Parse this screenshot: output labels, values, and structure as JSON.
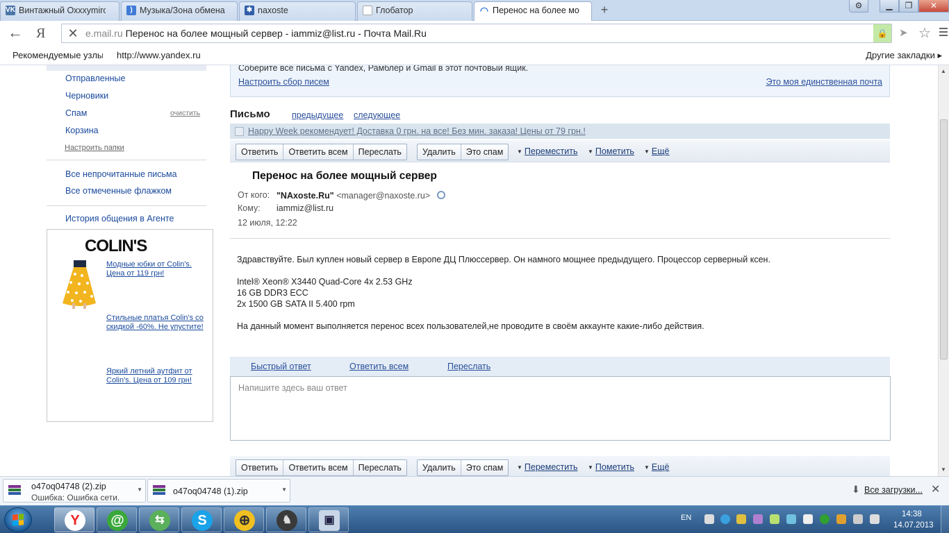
{
  "browser": {
    "tabs": [
      {
        "label": "Винтажный Охххуmiro",
        "favicon": "VK",
        "color": "#4a76a8"
      },
      {
        "label": "Музыка/Зона обмена",
        "favicon": ")",
        "color": "#3f7bd6"
      },
      {
        "label": "naxoste",
        "favicon": "✱",
        "color": "#2f5ea8"
      },
      {
        "label": "Глобатор",
        "favicon": "",
        "color": "#ffffff"
      },
      {
        "label": "Перенос на более мо",
        "favicon": "◠",
        "color": "#3f7bd6"
      }
    ],
    "new_tab_glyph": "+",
    "address": {
      "domain": "e.mail.ru",
      "title": "Перенос на более мощный сервер - iammiz@list.ru - Почта Mail.Ru"
    },
    "yandex_glyph": "Я",
    "bookmarks": {
      "recommended": "Рекомендуемые узлы",
      "yandex": "http://www.yandex.ru",
      "other": "Другие закладки"
    }
  },
  "sidebar": {
    "folders": [
      "Отправленные",
      "Черновики",
      "Спам",
      "Корзина"
    ],
    "clean_label": "очистить",
    "setup_folders": "Настроить папки",
    "all_unread": "Все непрочитанные письма",
    "all_flagged": "Все отмеченные флажком",
    "agent_history": "История общения в Агенте",
    "ad": {
      "brand": "COLIN'S",
      "links": [
        "Модные юбки от Colin's. Цена от 119 грн!",
        "Стильные платья Colin's со скидкой -60%. Не упустите!",
        "Яркий летний аутфит от Colin's. Цена от 109 грн!"
      ]
    }
  },
  "collector": {
    "text": "Соберите все письма с Yandex, Рамблер и Gmail в этот почтовый ящик.",
    "setup": "Настроить сбор писем",
    "only_mail": "Это моя единственная почта"
  },
  "letter": {
    "heading": "Письмо",
    "prev": "предыдущее",
    "next": "следующее",
    "promo": "Happy Week рекомендует! Доставка 0 грн. на все! Без мин. заказа! Цены от 79 грн.!",
    "toolbar": {
      "reply": "Ответить",
      "reply_all": "Ответить всем",
      "forward": "Переслать",
      "delete": "Удалить",
      "spam": "Это спам",
      "move": "Переместить",
      "mark": "Пометить",
      "more": "Ещё"
    },
    "subject": "Перенос на более мощный сервер",
    "from_label": "От кого:",
    "from_name": "\"NAxoste.Ru\"",
    "from_email": "<manager@naxoste.ru>",
    "to_label": "Кому:",
    "to_value": "iammiz@list.ru",
    "date": "12 июля, 12:22",
    "body": {
      "line1": "Здравствуйте. Был куплен новый сервер в Европе ДЦ Плюссервер. Он намного мощнее предыдущего. Процессор серверный ксен.",
      "spec1": "Intel® Xeon® X3440 Quad-Core 4x 2.53 GHz",
      "spec2": "16 GB DDR3 ECC",
      "spec3": "2x 1500 GB SATA II 5.400 rpm",
      "line2": "На данный момент выполняется перенос всех пользователей,не проводите в своём аккаунте какие-либо действия."
    },
    "reply_bar": {
      "quick": "Быстрый ответ",
      "all": "Ответить всем",
      "forward": "Переслать"
    },
    "reply_placeholder": "Напишите здесь ваш ответ"
  },
  "downloads": {
    "items": [
      {
        "name": "o47oq04748 (2).zip",
        "status": "Ошибка: Ошибка сети."
      },
      {
        "name": "o47oq04748 (1).zip",
        "status": ""
      }
    ],
    "all": "Все загрузки..."
  },
  "taskbar": {
    "lang": "EN",
    "time": "14:38",
    "date": "14.07.2013"
  }
}
